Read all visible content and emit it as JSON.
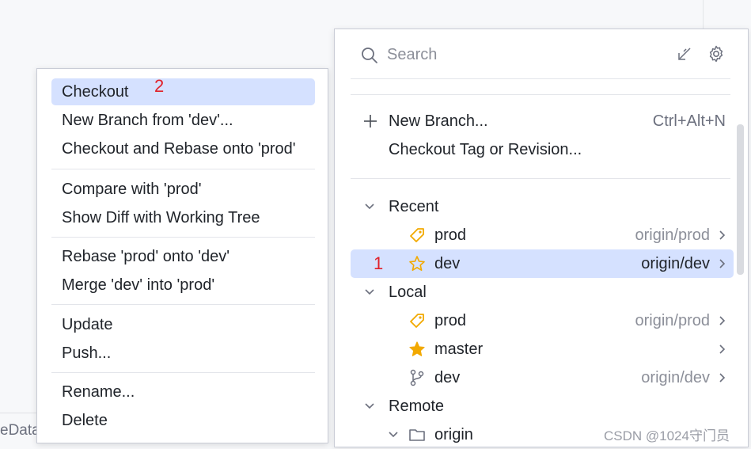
{
  "background": {
    "partial_text": "eData"
  },
  "annotations": {
    "menu_marker": "2",
    "branch_marker": "1"
  },
  "context_menu": {
    "groups": [
      [
        "Checkout",
        "New Branch from 'dev'...",
        "Checkout and Rebase onto 'prod'"
      ],
      [
        "Compare with 'prod'",
        "Show Diff with Working Tree"
      ],
      [
        "Rebase 'prod' onto 'dev'",
        "Merge 'dev' into 'prod'"
      ],
      [
        "Update",
        "Push..."
      ],
      [
        "Rename...",
        "Delete"
      ]
    ],
    "selected": "Checkout"
  },
  "branch_popup": {
    "search": {
      "placeholder": "Search"
    },
    "actions": {
      "new_branch": {
        "label": "New Branch...",
        "shortcut": "Ctrl+Alt+N"
      },
      "checkout_tag": {
        "label": "Checkout Tag or Revision..."
      }
    },
    "sections": {
      "recent": {
        "label": "Recent",
        "items": [
          {
            "name": "prod",
            "remote": "origin/prod",
            "icon": "tag-icon"
          },
          {
            "name": "dev",
            "remote": "origin/dev",
            "icon": "star-outline-icon",
            "selected": true
          }
        ]
      },
      "local": {
        "label": "Local",
        "items": [
          {
            "name": "prod",
            "remote": "origin/prod",
            "icon": "tag-icon"
          },
          {
            "name": "master",
            "remote": "",
            "icon": "star-filled-icon"
          },
          {
            "name": "dev",
            "remote": "origin/dev",
            "icon": "branch-icon"
          }
        ]
      },
      "remote": {
        "label": "Remote",
        "items": [
          {
            "name": "origin",
            "icon": "folder-icon"
          }
        ]
      }
    }
  },
  "colors": {
    "selection": "#d5e1ff",
    "accent_icon": "#f2a900",
    "annotation": "#e0202a"
  },
  "watermark": "CSDN @1024守门员"
}
